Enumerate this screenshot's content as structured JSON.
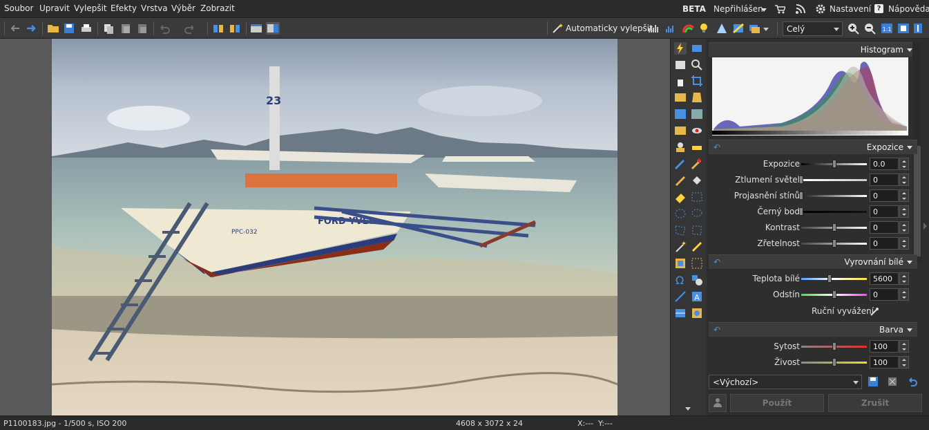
{
  "menu": {
    "items": [
      "Soubor",
      "Upravit",
      "Vylepšit",
      "Efekty",
      "Vrstva",
      "Výběr",
      "Zobrazit"
    ]
  },
  "topright": {
    "beta": "BETA",
    "login": "Nepřihlášen",
    "settings": "Nastavení",
    "help": "Nápověda"
  },
  "toolbar": {
    "auto_enhance": "Automaticky vylepšit",
    "zoom_select": "Celý"
  },
  "histogram": {
    "title": "Histogram"
  },
  "exposure": {
    "title": "Expozice",
    "rows": [
      {
        "label": "Expozice",
        "value": "0.0",
        "level": 0.5
      },
      {
        "label": "Ztlumení světel",
        "value": "0",
        "level": 0.0
      },
      {
        "label": "Projasnění stínů",
        "value": "0",
        "level": 0.0
      },
      {
        "label": "Černý bod",
        "value": "0",
        "level": 0.0
      },
      {
        "label": "Kontrast",
        "value": "0",
        "level": 0.5
      },
      {
        "label": "Zřetelnost",
        "value": "0",
        "level": 0.5
      }
    ]
  },
  "white_balance": {
    "title": "Vyrovnání bílé",
    "rows": [
      {
        "label": "Teplota bílé",
        "value": "5600",
        "level": 0.43
      },
      {
        "label": "Odstín",
        "value": "0",
        "level": 0.5
      }
    ],
    "manual": "Ruční vyvážení"
  },
  "color": {
    "title": "Barva",
    "rows": [
      {
        "label": "Sytost",
        "value": "100",
        "level": 0.5
      },
      {
        "label": "Živost",
        "value": "100",
        "level": 0.5
      }
    ]
  },
  "preset": {
    "value": "<Výchozí>"
  },
  "actions": {
    "apply": "Použít",
    "cancel": "Zrušit"
  },
  "status": {
    "file": "P1100183.jpg - 1/500 s, ISO 200",
    "dims": "4608 x 3072 x 24",
    "x": "X:---",
    "y": "Y:---"
  },
  "photo": {
    "boat_number": "23",
    "hull_text": "FORD YVES",
    "reg": "PPC-032"
  }
}
